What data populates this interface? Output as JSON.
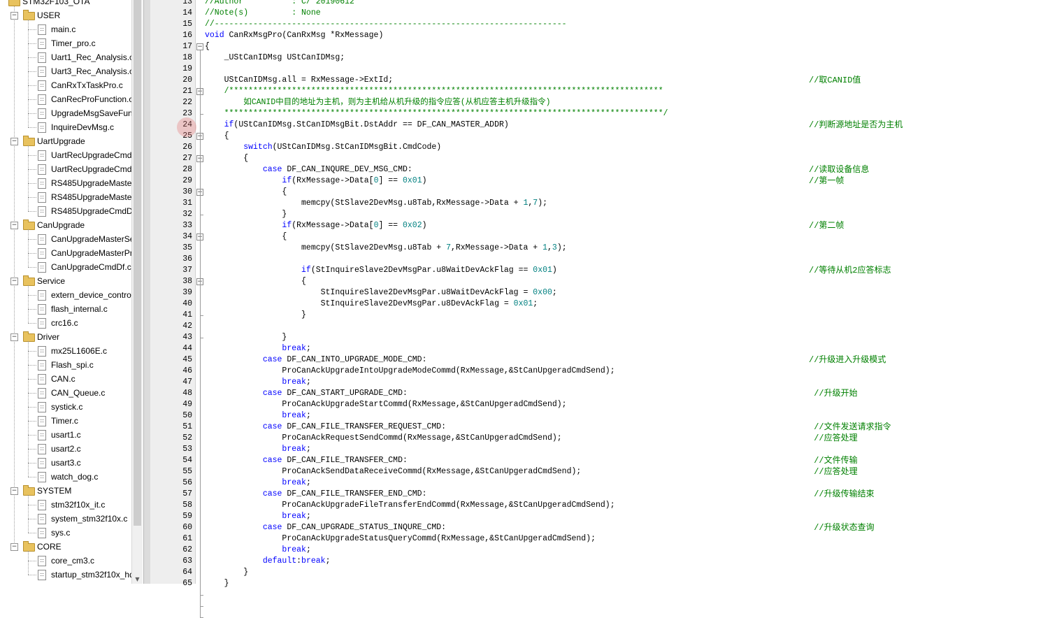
{
  "project_tree": {
    "root_label": "STM32F103_OTA",
    "groups": [
      {
        "name": "USER",
        "files": [
          "main.c",
          "Timer_pro.c",
          "Uart1_Rec_Analysis.c",
          "Uart3_Rec_Analysis.c",
          "CanRxTxTaskPro.c",
          "CanRecProFunction.c",
          "UpgradeMsgSaveFun",
          "InquireDevMsg.c"
        ]
      },
      {
        "name": "UartUpgrade",
        "files": [
          "UartRecUpgradeCmdl",
          "UartRecUpgradeCmdl",
          "RS485UpgradeMaster",
          "RS485UpgradeMasterl",
          "RS485UpgradeCmdDf"
        ]
      },
      {
        "name": "CanUpgrade",
        "files": [
          "CanUpgradeMasterSe",
          "CanUpgradeMasterPr",
          "CanUpgradeCmdDf.c"
        ]
      },
      {
        "name": "Service",
        "files": [
          "extern_device_control",
          "flash_internal.c",
          "crc16.c"
        ]
      },
      {
        "name": "Driver",
        "files": [
          "mx25L1606E.c",
          "Flash_spi.c",
          "CAN.c",
          "CAN_Queue.c",
          "systick.c",
          "Timer.c",
          "usart1.c",
          "usart2.c",
          "usart3.c",
          "watch_dog.c"
        ]
      },
      {
        "name": "SYSTEM",
        "files": [
          "stm32f10x_it.c",
          "system_stm32f10x.c",
          "sys.c"
        ]
      },
      {
        "name": "CORE",
        "files": [
          "core_cm3.c",
          "startup_stm32f10x_hd"
        ]
      }
    ]
  },
  "editor": {
    "first_line": 13,
    "lines": [
      {
        "c": "//Author          : C/ 20190612",
        "k": "gc"
      },
      {
        "c": "//Note(s)         : None",
        "k": "gc"
      },
      {
        "c": "//-------------------------------------------------------------------------",
        "k": "gc"
      },
      {
        "c": "void CanRxMsgPro(CanRxMsg *RxMessage)",
        "k": "fn"
      },
      {
        "c": "{"
      },
      {
        "c": "    _UStCanIDMsg UStCanIDMsg;"
      },
      {
        "c": ""
      },
      {
        "c": "    UStCanIDMsg.all = RxMessage->ExtId;",
        "cm": "//取CANID值"
      },
      {
        "c": "    /******************************************************************************************",
        "k": "gc"
      },
      {
        "c": "        如CANID中目的地址为主机，则为主机给从机升级的指令应答(从机应答主机升级指令)",
        "k": "gc"
      },
      {
        "c": "    *******************************************************************************************/",
        "k": "gc"
      },
      {
        "c": "    if(UStCanIDMsg.StCanIDMsgBit.DstAddr == DF_CAN_MASTER_ADDR)",
        "cm": "//判断源地址是否为主机"
      },
      {
        "c": "    {"
      },
      {
        "c": "        switch(UStCanIDMsg.StCanIDMsgBit.CmdCode)"
      },
      {
        "c": "        {"
      },
      {
        "c": "            case DF_CAN_INQURE_DEV_MSG_CMD:",
        "cm": "//读取设备信息"
      },
      {
        "c": "                if(RxMessage->Data[0] == 0x01)",
        "cm": "//第一帧"
      },
      {
        "c": "                {"
      },
      {
        "c": "                    memcpy(StSlave2DevMsg.u8Tab,RxMessage->Data + 1,7);"
      },
      {
        "c": "                }"
      },
      {
        "c": "                if(RxMessage->Data[0] == 0x02)",
        "cm": "//第二帧"
      },
      {
        "c": "                {"
      },
      {
        "c": "                    memcpy(StSlave2DevMsg.u8Tab + 7,RxMessage->Data + 1,3);"
      },
      {
        "c": ""
      },
      {
        "c": "                    if(StInquireSlave2DevMsgPar.u8WaitDevAckFlag == 0x01)",
        "cm": "//等待从机2应答标志"
      },
      {
        "c": "                    {"
      },
      {
        "c": "                        StInquireSlave2DevMsgPar.u8WaitDevAckFlag = 0x00;"
      },
      {
        "c": "                        StInquireSlave2DevMsgPar.u8DevAckFlag = 0x01;"
      },
      {
        "c": "                    }"
      },
      {
        "c": ""
      },
      {
        "c": "                }"
      },
      {
        "c": "                break;"
      },
      {
        "c": "            case DF_CAN_INTO_UPGRADE_MODE_CMD:",
        "cm": "//升级进入升级模式"
      },
      {
        "c": "                ProCanAckUpgradeIntoUpgradeModeCommd(RxMessage,&StCanUpgeradCmdSend);"
      },
      {
        "c": "                break;"
      },
      {
        "c": "            case DF_CAN_START_UPGRADE_CMD:",
        "cm": " //升级开始"
      },
      {
        "c": "                ProCanAckUpgradeStartCommd(RxMessage,&StCanUpgeradCmdSend);"
      },
      {
        "c": "                break;"
      },
      {
        "c": "            case DF_CAN_FILE_TRANSFER_REQUEST_CMD:",
        "cm": " //文件发送请求指令"
      },
      {
        "c": "                ProCanAckRequestSendCommd(RxMessage,&StCanUpgeradCmdSend);",
        "cm": " //应答处理"
      },
      {
        "c": "                break;"
      },
      {
        "c": "            case DF_CAN_FILE_TRANSFER_CMD:",
        "cm": " //文件传输"
      },
      {
        "c": "                ProCanAckSendDataReceiveCommd(RxMessage,&StCanUpgeradCmdSend);",
        "cm": " //应答处理"
      },
      {
        "c": "                break;"
      },
      {
        "c": "            case DF_CAN_FILE_TRANSFER_END_CMD:",
        "cm": " //升级传输结束"
      },
      {
        "c": "                ProCanAckUpgradeFileTransferEndCommd(RxMessage,&StCanUpgeradCmdSend);"
      },
      {
        "c": "                break;"
      },
      {
        "c": "            case DF_CAN_UPGRADE_STATUS_INQURE_CMD:",
        "cm": " //升级状态查询"
      },
      {
        "c": "                ProCanAckUpgradeStatusQueryCommd(RxMessage,&StCanUpgeradCmdSend);"
      },
      {
        "c": "                break;"
      },
      {
        "c": "            default:break;"
      },
      {
        "c": "        }"
      },
      {
        "c": "    }"
      }
    ]
  },
  "colors": {
    "keyword": "#0000ff",
    "number": "#008080",
    "comment": "#008000",
    "gutter": "#eeeeee"
  }
}
